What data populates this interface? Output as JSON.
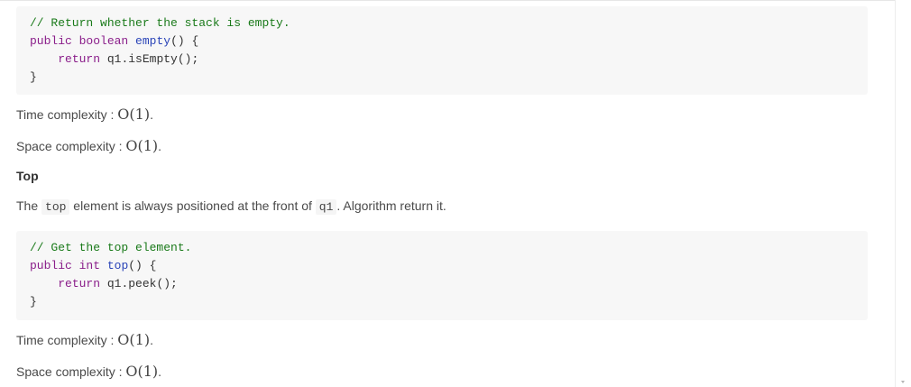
{
  "empty_section": {
    "code": {
      "comment": "// Return whether the stack is empty.",
      "kw_public": "public",
      "type": "boolean",
      "fn_name": "empty",
      "sig_tail": "() {",
      "kw_return": "return",
      "body_expr": "q1.isEmpty();",
      "close": "}"
    },
    "time_label": "Time complexity : ",
    "time_value": "O(1)",
    "time_end": ".",
    "space_label": "Space complexity : ",
    "space_value": "O(1)",
    "space_end": "."
  },
  "top_section": {
    "heading": "Top",
    "desc": {
      "pre": "The ",
      "code1": "top",
      "mid": " element is always positioned at the front of ",
      "code2": "q1",
      "post": ". Algorithm return it."
    },
    "code": {
      "comment": "// Get the top element.",
      "kw_public": "public",
      "type": "int",
      "fn_name": "top",
      "sig_tail": "() {",
      "kw_return": "return",
      "body_expr": "q1.peek();",
      "close": "}"
    },
    "time_label": "Time complexity : ",
    "time_value": "O(1)",
    "time_end": ".",
    "space_label": "Space complexity : ",
    "space_value": "O(1)",
    "space_end": "."
  }
}
